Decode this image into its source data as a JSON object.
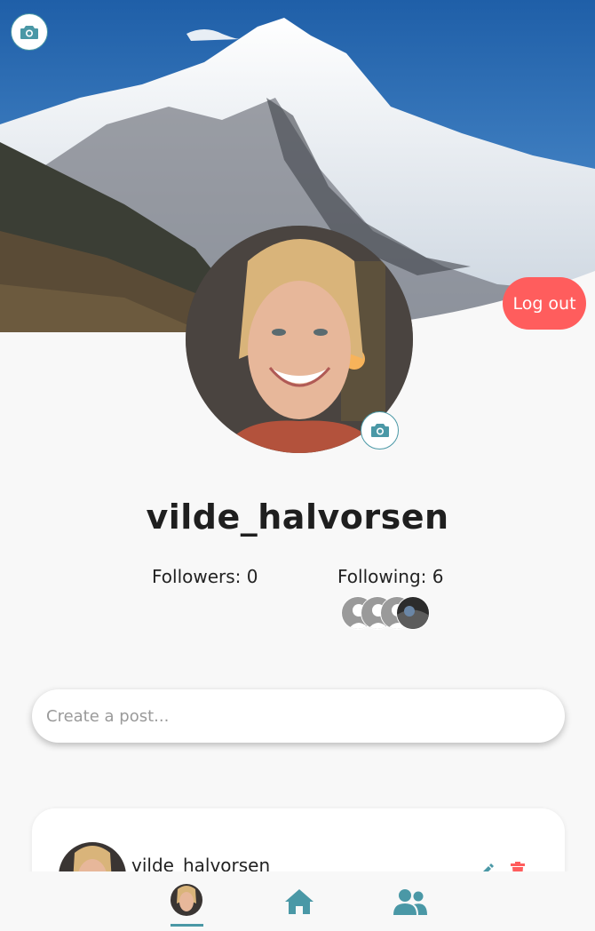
{
  "profile": {
    "username": "vilde_halvorsen",
    "followers_label": "Followers: 0",
    "following_label": "Following: 6",
    "following_avatars": [
      "user-avatar",
      "user-avatar",
      "user-avatar",
      "user-avatar"
    ]
  },
  "header": {
    "logout_label": "Log out",
    "cover_camera_icon": "camera-icon",
    "avatar_camera_icon": "camera-icon"
  },
  "composer": {
    "placeholder": "Create a post..."
  },
  "posts": [
    {
      "author": "vilde_halvorsen",
      "edit_icon": "pencil-icon",
      "delete_icon": "trash-icon"
    }
  ],
  "nav": {
    "items": [
      "profile",
      "home-icon",
      "users-icon"
    ],
    "active": "profile"
  },
  "colors": {
    "accent": "#4a98a6",
    "logout": "#ff5d5d",
    "background": "#f8f8f8"
  }
}
